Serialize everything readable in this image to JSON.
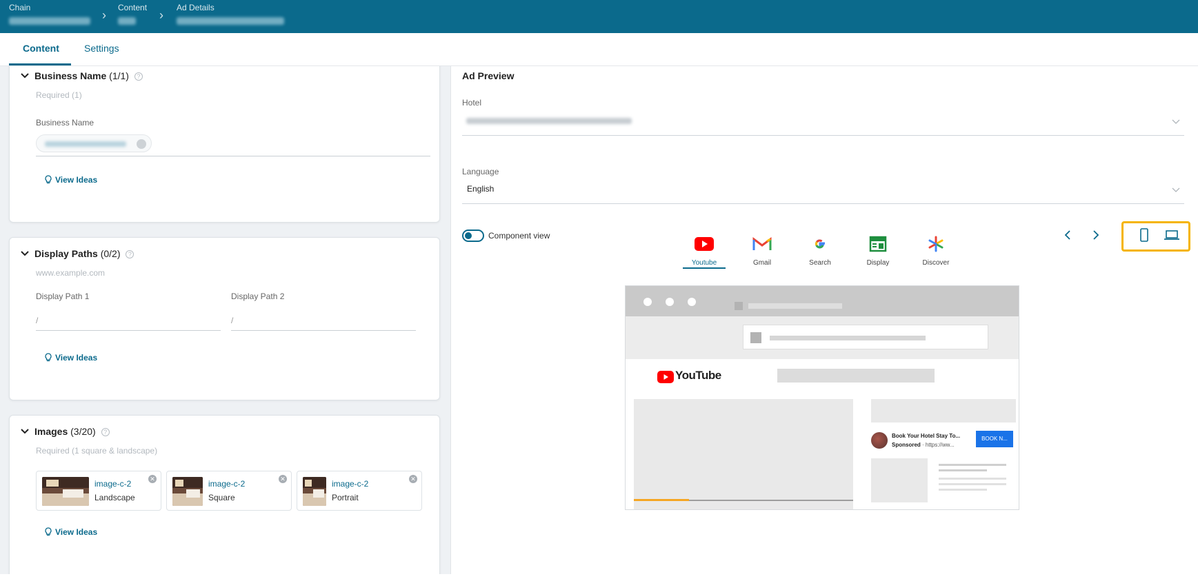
{
  "breadcrumb": [
    {
      "label": "Chain",
      "value": "Wing International"
    },
    {
      "label": "Content",
      "value": "Ads"
    },
    {
      "label": "Ad Details",
      "value": "PMAX Hotel Chaincopy"
    }
  ],
  "tabs": [
    {
      "label": "Content",
      "active": true
    },
    {
      "label": "Settings",
      "active": false
    }
  ],
  "left": {
    "business_name": {
      "title": "Business Name",
      "count": "(1/1)",
      "hint": "Required (1)",
      "field_label": "Business Name",
      "chip_value": "Wing Business Name",
      "view_ideas": "View Ideas"
    },
    "display_paths": {
      "title": "Display Paths",
      "count": "(0/2)",
      "hint": "www.example.com",
      "path1_label": "Display Path 1",
      "path2_label": "Display Path 2",
      "path1_value": "/",
      "path2_value": "/",
      "view_ideas": "View Ideas"
    },
    "images": {
      "title": "Images",
      "count": "(3/20)",
      "hint": "Required (1 square & landscape)",
      "items": [
        {
          "name": "image-c-2",
          "kind": "Landscape"
        },
        {
          "name": "image-c-2",
          "kind": "Square"
        },
        {
          "name": "image-c-2",
          "kind": "Portrait"
        }
      ],
      "view_ideas": "View Ideas"
    }
  },
  "preview": {
    "title": "Ad Preview",
    "hotel_label": "Hotel",
    "hotel_value": "Hotel Wing International Kuchbwea Elkmar",
    "language_label": "Language",
    "language_value": "English",
    "component_view_label": "Component view",
    "component_view_on": true,
    "platforms": [
      {
        "label": "Youtube",
        "icon": "youtube-icon",
        "active": true
      },
      {
        "label": "Gmail",
        "icon": "gmail-icon",
        "active": false
      },
      {
        "label": "Search",
        "icon": "google-icon",
        "active": false
      },
      {
        "label": "Display",
        "icon": "display-icon",
        "active": false
      },
      {
        "label": "Discover",
        "icon": "discover-icon",
        "active": false
      }
    ],
    "mock": {
      "brand": "YouTube",
      "ad_title": "Book Your Hotel Stay To...",
      "ad_sponsored": "Sponsored",
      "ad_url": "https://ww...",
      "ad_button": "BOOK N...",
      "progress_fraction": 0.25
    }
  },
  "colors": {
    "brand": "#0b6a8c",
    "highlight": "#f5b400",
    "youtube_red": "#ff0000",
    "ad_button": "#1a73e8"
  }
}
